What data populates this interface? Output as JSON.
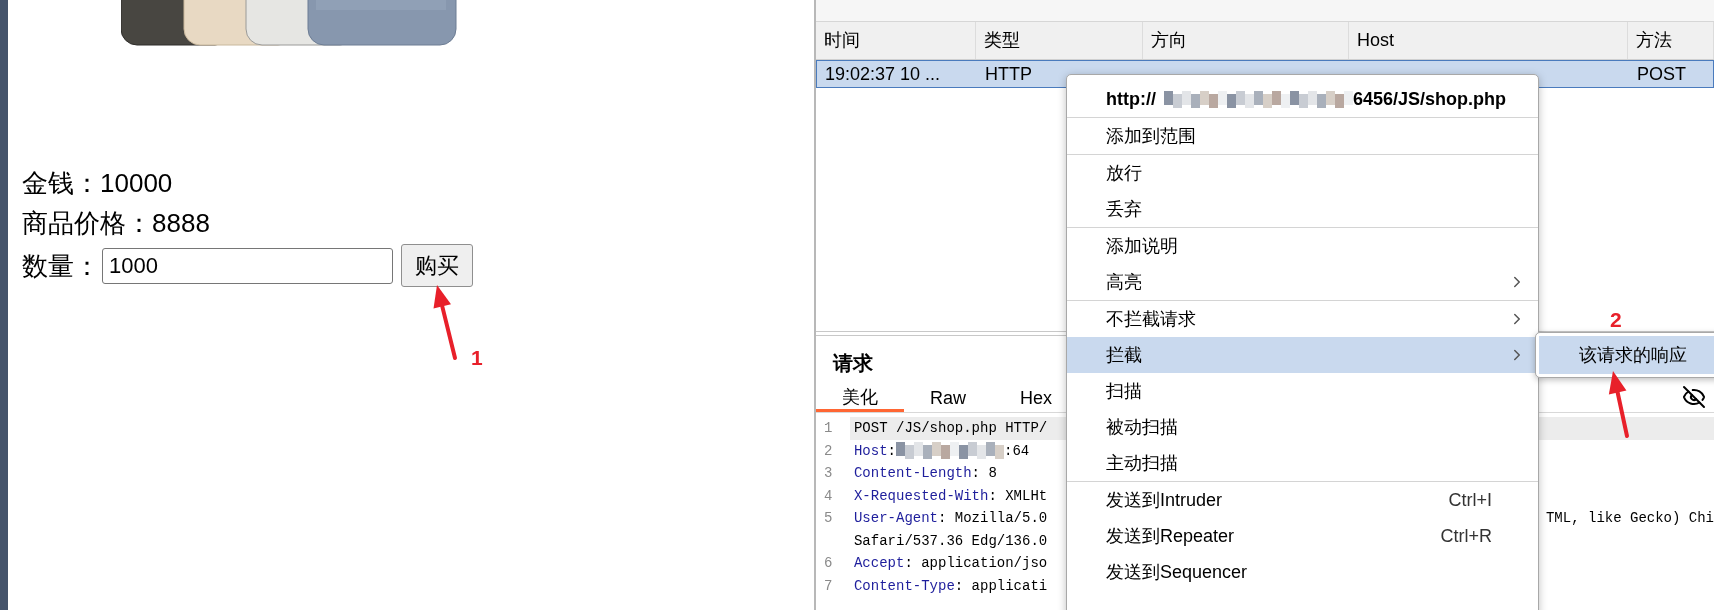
{
  "shop": {
    "money_label": "金钱：",
    "money": "10000",
    "price_label": "商品价格：",
    "price": "8888",
    "quantity_label": "数量：",
    "quantity": "1000",
    "buy_button": "购买"
  },
  "annotations": [
    {
      "label": "1"
    },
    {
      "label": "2"
    }
  ],
  "proxy_table": {
    "columns": [
      "时间",
      "类型",
      "方向",
      "Host",
      "方法"
    ],
    "rows": [
      {
        "selected": true,
        "time": "19:02:37 10 ...",
        "type": "HTTP",
        "method": "POST"
      }
    ]
  },
  "context_menu": {
    "title_prefix": "http://",
    "title_suffix": "6456/JS/shop.php",
    "groups": [
      [
        {
          "label": "添加到范围",
          "submenu": false,
          "selected": false
        }
      ],
      [
        {
          "label": "放行",
          "submenu": false,
          "selected": false
        },
        {
          "label": "丢弃",
          "submenu": false,
          "selected": false
        }
      ],
      [
        {
          "label": "添加说明",
          "submenu": false,
          "selected": false
        },
        {
          "label": "高亮",
          "submenu": true,
          "selected": false
        }
      ],
      [
        {
          "label": "不拦截请求",
          "submenu": true,
          "selected": false
        },
        {
          "label": "拦截",
          "submenu": true,
          "selected": true
        },
        {
          "label": "扫描",
          "submenu": false,
          "selected": false
        },
        {
          "label": "被动扫描",
          "submenu": false,
          "selected": false
        },
        {
          "label": "主动扫描",
          "submenu": false,
          "selected": false
        }
      ],
      [
        {
          "label": "发送到Intruder",
          "shortcut": "Ctrl+I",
          "submenu": false,
          "selected": false
        },
        {
          "label": "发送到Repeater",
          "shortcut": "Ctrl+R",
          "submenu": false,
          "selected": false
        },
        {
          "label": "发送到Sequencer",
          "submenu": false,
          "selected": false
        }
      ]
    ]
  },
  "submenu": {
    "items": [
      {
        "label": "该请求的响应",
        "selected": true
      }
    ]
  },
  "request": {
    "title": "请求",
    "tabs": [
      {
        "label": "美化",
        "selected": true
      },
      {
        "label": "Raw",
        "selected": false
      },
      {
        "label": "Hex",
        "selected": false
      }
    ],
    "lines": [
      {
        "number": "1",
        "highlighted": true,
        "parts": [
          {
            "kind": "plain",
            "text": "POST /JS/shop.php HTTP/"
          }
        ]
      },
      {
        "number": "2",
        "highlighted": false,
        "parts": [
          {
            "kind": "key",
            "text": "Host"
          },
          {
            "kind": "plain",
            "text": ":"
          },
          {
            "kind": "redacted"
          },
          {
            "kind": "plain",
            "text": ":64"
          }
        ]
      },
      {
        "number": "3",
        "highlighted": false,
        "parts": [
          {
            "kind": "key",
            "text": "Content-Length"
          },
          {
            "kind": "plain",
            "text": ": 8"
          }
        ]
      },
      {
        "number": "4",
        "highlighted": false,
        "parts": [
          {
            "kind": "key",
            "text": "X-Requested-With"
          },
          {
            "kind": "plain",
            "text": ": XMLHt"
          }
        ]
      },
      {
        "number": "5",
        "highlighted": false,
        "parts": [
          {
            "kind": "key",
            "text": "User-Agent"
          },
          {
            "kind": "plain",
            "text": ": Mozilla/5.0"
          }
        ],
        "tail": "TML, like Gecko) Chi"
      },
      {
        "highlighted": false,
        "parts": [
          {
            "kind": "plain",
            "text": "Safari/537.36 Edg/136.0"
          }
        ]
      },
      {
        "number": "6",
        "highlighted": false,
        "parts": [
          {
            "kind": "key",
            "text": "Accept"
          },
          {
            "kind": "plain",
            "text": ": application/jso"
          }
        ]
      },
      {
        "number": "7",
        "highlighted": false,
        "parts": [
          {
            "kind": "key",
            "text": "Content-Type"
          },
          {
            "kind": "plain",
            "text": ": applicati"
          }
        ]
      }
    ]
  }
}
